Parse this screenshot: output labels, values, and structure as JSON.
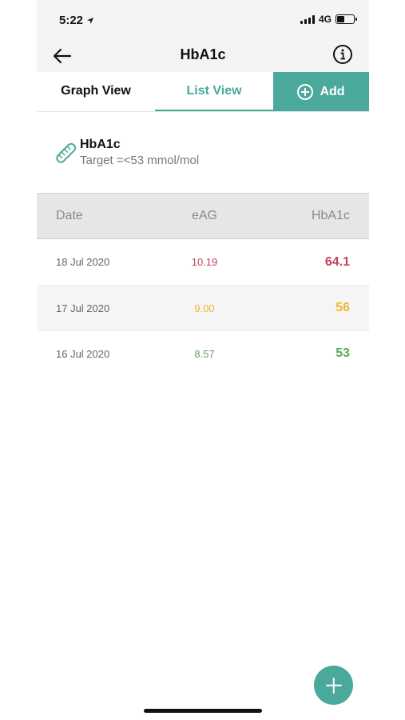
{
  "status_bar": {
    "time": "5:22",
    "network": "4G",
    "battery_level": 0.45
  },
  "nav": {
    "title": "HbA1c",
    "back_icon": "arrow-left-icon",
    "info_icon": "info-icon"
  },
  "tabs": {
    "graph": "Graph View",
    "list": "List View",
    "add": "Add",
    "active": "List View"
  },
  "metric": {
    "name": "HbA1c",
    "target": "Target =<53 mmol/mol",
    "icon": "test-tube-icon"
  },
  "table": {
    "headers": {
      "date": "Date",
      "eag": "eAG",
      "hba1c": "HbA1c"
    },
    "rows": [
      {
        "date": "18 Jul 2020",
        "eag": "10.19",
        "hba1c": "64.1",
        "color": "#c2435a"
      },
      {
        "date": "17 Jul 2020",
        "eag": "9.00",
        "hba1c": "56",
        "color": "#f2b531"
      },
      {
        "date": "16 Jul 2020",
        "eag": "8.57",
        "hba1c": "53",
        "color": "#5aa85a"
      }
    ]
  },
  "colors": {
    "accent": "#4aa99a",
    "high": "#c2435a",
    "moderate": "#f2b531",
    "normal": "#5aa85a"
  },
  "fab_icon": "plus-icon"
}
